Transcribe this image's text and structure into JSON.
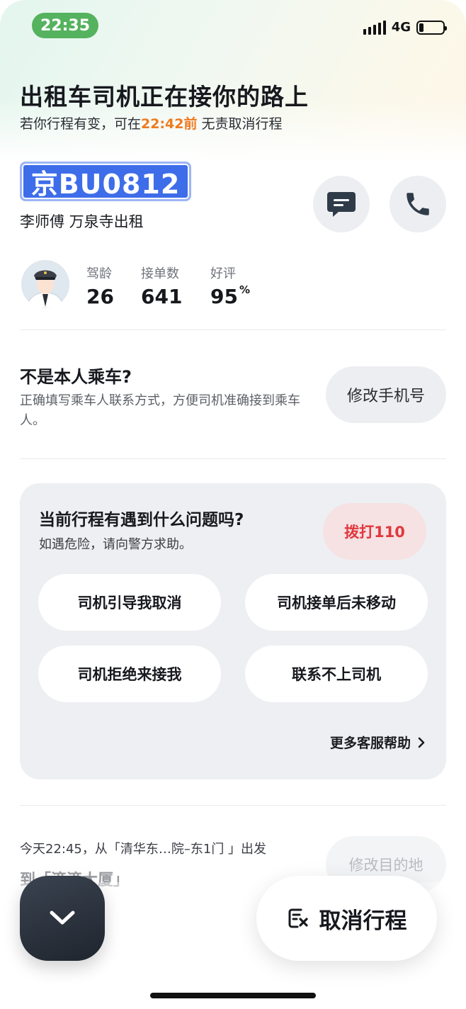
{
  "status_bar": {
    "time": "22:35",
    "network": "4G",
    "battery_level": 0.2
  },
  "header": {
    "title": "出租车司机正在接你的路上",
    "subtitle_prefix": "若你行程有变，可在",
    "cancel_deadline": "22:42前",
    "subtitle_suffix": " 无责取消行程"
  },
  "driver": {
    "plate": "京BU0812",
    "info": "李师傅 万泉寺出租",
    "message_icon": "chat-icon",
    "phone_icon": "phone-icon",
    "stats": [
      {
        "label": "驾龄",
        "value": "26",
        "unit": ""
      },
      {
        "label": "接单数",
        "value": "641",
        "unit": ""
      },
      {
        "label": "好评",
        "value": "95",
        "unit": "%"
      }
    ]
  },
  "passenger_section": {
    "title": "不是本人乘车?",
    "description": "正确填写乘车人联系方式，方便司机准确接到乘车人。",
    "button_label": "修改手机号"
  },
  "problem_section": {
    "title": "当前行程有遇到什么问题吗?",
    "description": "如遇危险，请向警方求助。",
    "call_police_label": "拨打110",
    "options": [
      "司机引导我取消",
      "司机接单后未移动",
      "司机拒绝来接我",
      "联系不上司机"
    ],
    "more_help_label": "更多客服帮助"
  },
  "trip": {
    "departure_text": "今天22:45，从「清华东…院–东1门 」出发",
    "destination_text": "到「滴滴大厦」",
    "edit_destination_label": "修改目的地"
  },
  "actions": {
    "cancel_trip_label": "取消行程"
  },
  "colors": {
    "accent_orange": "#ef7a1f",
    "plate_blue": "#3e6dea",
    "alert_red": "#e0383d",
    "status_green": "#55b25e"
  }
}
